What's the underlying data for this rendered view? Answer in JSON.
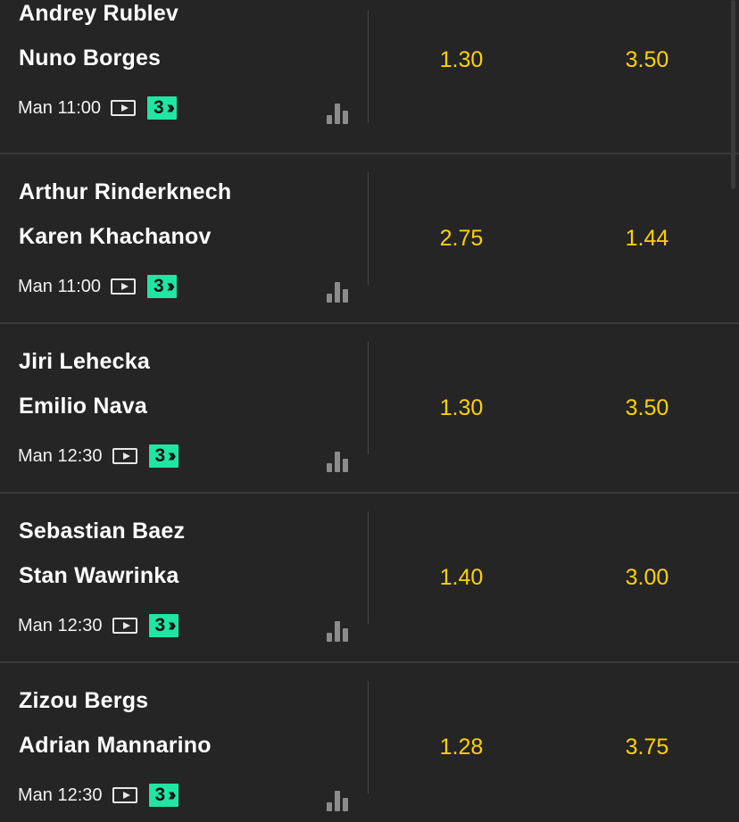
{
  "matches": [
    {
      "player1": "Andrey Rublev",
      "player2": "Nuno Borges",
      "time": "Man 11:00",
      "badge_count": "3",
      "odds": [
        "1.30",
        "3.50"
      ]
    },
    {
      "player1": "Arthur Rinderknech",
      "player2": "Karen Khachanov",
      "time": "Man 11:00",
      "badge_count": "3",
      "odds": [
        "2.75",
        "1.44"
      ]
    },
    {
      "player1": "Jiri Lehecka",
      "player2": "Emilio Nava",
      "time": "Man 12:30",
      "badge_count": "3",
      "odds": [
        "1.30",
        "3.50"
      ]
    },
    {
      "player1": "Sebastian Baez",
      "player2": "Stan Wawrinka",
      "time": "Man 12:30",
      "badge_count": "3",
      "odds": [
        "1.40",
        "3.00"
      ]
    },
    {
      "player1": "Zizou Bergs",
      "player2": "Adrian Mannarino",
      "time": "Man 12:30",
      "badge_count": "3",
      "odds": [
        "1.28",
        "3.75"
      ]
    }
  ],
  "icons": {
    "play": "play-icon",
    "badge_arrow": "double-chevron-right-icon",
    "stats": "bar-chart-icon"
  },
  "colors": {
    "background": "#252525",
    "odds_text": "#ffd200",
    "badge_bg": "#21e5a2",
    "separator": "#3a3a3a"
  }
}
